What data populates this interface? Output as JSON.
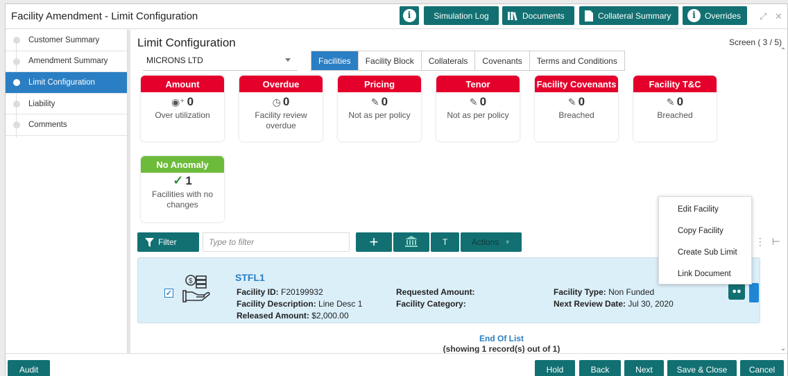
{
  "window": {
    "title": "Facility Amendment - Limit Configuration",
    "toolbar": {
      "info_label": "i",
      "simulation_log": "Simulation Log",
      "documents": "Documents",
      "collateral_summary": "Collateral Summary",
      "overrides": "Overrides"
    }
  },
  "sidebar": {
    "items": [
      {
        "label": "Customer Summary",
        "active": false
      },
      {
        "label": "Amendment Summary",
        "active": false
      },
      {
        "label": "Limit Configuration",
        "active": true
      },
      {
        "label": "Liability",
        "active": false
      },
      {
        "label": "Comments",
        "active": false
      }
    ]
  },
  "main": {
    "title": "Limit Configuration",
    "screen": "Screen ( 3 / 5)",
    "customer_select": "MICRONS LTD",
    "tabs": [
      "Facilities",
      "Facility Block",
      "Collaterals",
      "Covenants",
      "Terms and Conditions"
    ],
    "active_tab": "Facilities"
  },
  "cards": [
    {
      "header": "Amount",
      "value": "0",
      "desc": "Over utilization",
      "icon": "money-bag-icon",
      "color": "#e4002b"
    },
    {
      "header": "Overdue",
      "value": "0",
      "desc": "Facility review overdue",
      "icon": "timer-icon",
      "color": "#e4002b"
    },
    {
      "header": "Pricing",
      "value": "0",
      "desc": "Not as per policy",
      "icon": "edit-doc-icon",
      "color": "#e4002b"
    },
    {
      "header": "Tenor",
      "value": "0",
      "desc": "Not as per policy",
      "icon": "edit-doc-icon",
      "color": "#e4002b"
    },
    {
      "header": "Facility Covenants",
      "value": "0",
      "desc": "Breached",
      "icon": "edit-doc-icon",
      "color": "#e4002b"
    },
    {
      "header": "Facility T&C",
      "value": "0",
      "desc": "Breached",
      "icon": "edit-doc-icon",
      "color": "#e4002b"
    },
    {
      "header": "No Anomaly",
      "value": "1",
      "desc": "Facilities with no changes",
      "icon": "check-icon",
      "color": "#6dbb3b"
    }
  ],
  "filter": {
    "button": "Filter",
    "placeholder": "Type to filter",
    "t_button": "T",
    "actions": "Actions"
  },
  "context_menu": [
    "Edit Facility",
    "Copy Facility",
    "Create Sub Limit",
    "Link Document"
  ],
  "record": {
    "name": "STFL1",
    "facility_id_label": "Facility ID:",
    "facility_id": "F20199932",
    "facility_desc_label": "Facility Description:",
    "facility_desc": "Line Desc 1",
    "released_label": "Released Amount:",
    "released": "$2,000.00",
    "requested_label": "Requested Amount:",
    "category_label": "Facility Category:",
    "type_label": "Facility Type:",
    "type": "Non Funded",
    "review_label": "Next Review Date:",
    "review": "Jul 30, 2020",
    "checked": true
  },
  "list_footer": {
    "end": "End Of List",
    "summary": "(showing 1 record(s) out of 1)"
  },
  "footer": {
    "audit": "Audit",
    "hold": "Hold",
    "back": "Back",
    "next": "Next",
    "save_close": "Save & Close",
    "cancel": "Cancel"
  }
}
